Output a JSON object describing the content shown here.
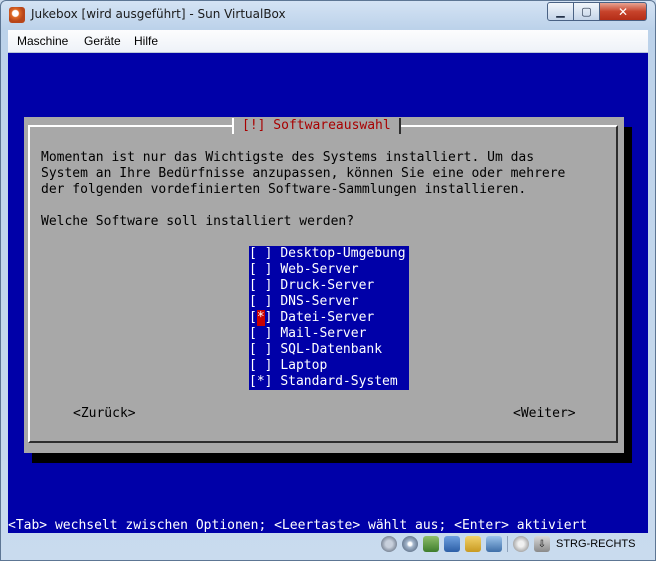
{
  "window": {
    "title": "Jukebox [wird ausgeführt] - Sun VirtualBox",
    "minimize_glyph": "▁",
    "maximize_glyph": "▢",
    "close_glyph": "✕"
  },
  "menubar": {
    "items": [
      "Maschine",
      "Geräte",
      "Hilfe"
    ]
  },
  "installer": {
    "dialog_title": "[!] Softwareauswahl",
    "body_lines": [
      "Momentan ist nur das Wichtigste des Systems installiert. Um das",
      "System an Ihre Bedürfnisse anzupassen, können Sie eine oder mehrere",
      "der folgenden vordefinierten Software-Sammlungen installieren."
    ],
    "question": "Welche Software soll installiert werden?",
    "options": [
      {
        "label": "Desktop-Umgebung",
        "checked": false,
        "box_open": "[",
        "box_mark": " ",
        "box_close": "]"
      },
      {
        "label": "Web-Server",
        "checked": false,
        "box_open": "[",
        "box_mark": " ",
        "box_close": "]"
      },
      {
        "label": "Druck-Server",
        "checked": false,
        "box_open": "[",
        "box_mark": " ",
        "box_close": "]"
      },
      {
        "label": "DNS-Server",
        "checked": false,
        "box_open": "[",
        "box_mark": " ",
        "box_close": "]"
      },
      {
        "label": "Datei-Server",
        "checked": true,
        "focused": true,
        "box_open": "[",
        "box_mark": "*",
        "box_close": "]"
      },
      {
        "label": "Mail-Server",
        "checked": false,
        "box_open": "[",
        "box_mark": " ",
        "box_close": "]"
      },
      {
        "label": "SQL-Datenbank",
        "checked": false,
        "box_open": "[",
        "box_mark": " ",
        "box_close": "]"
      },
      {
        "label": "Laptop",
        "checked": false,
        "box_open": "[",
        "box_mark": " ",
        "box_close": "]"
      },
      {
        "label": "Standard-System",
        "checked": true,
        "box_open": "[",
        "box_mark": "*",
        "box_close": "]"
      }
    ],
    "back_button": "<Zurück>",
    "next_button": "<Weiter>",
    "help_line": "<Tab> wechselt zwischen Optionen; <Leertaste> wählt aus; <Enter> aktiviert"
  },
  "statusbar": {
    "host_key": "STRG-RECHTS",
    "icons": [
      "hard-disk-icon",
      "cd-dvd-icon",
      "network-icon",
      "usb-icon",
      "shared-folders-icon",
      "display-icon",
      "mouse-integration-icon",
      "keyboard-capture-icon"
    ]
  },
  "colors": {
    "vm_background": "#0000a8",
    "dialog_gray": "#a8a8a8",
    "title_red": "#a80000",
    "focus_red": "#c80000"
  }
}
